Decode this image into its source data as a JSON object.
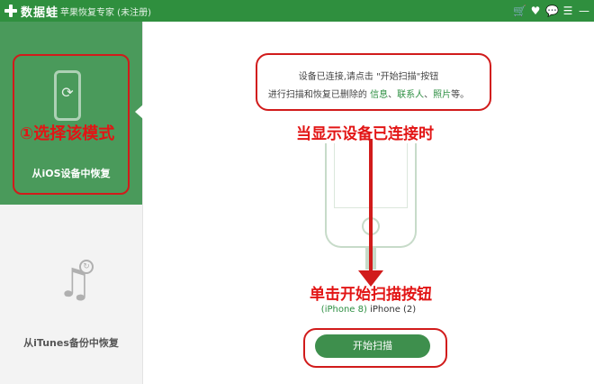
{
  "titlebar": {
    "app_name": "数据蛙",
    "subtitle": "苹果恢复专家 (未注册)",
    "controls": [
      "🛒",
      "♥",
      "💬",
      "☰",
      "—"
    ]
  },
  "sidebar": {
    "modes": [
      {
        "label": "从iOS设备中恢复",
        "active": true
      },
      {
        "label": "从iTunes备份中恢复",
        "active": false
      }
    ],
    "annotation": "①选择该模式"
  },
  "main": {
    "info_line1": "设备已连接,请点击 \"开始扫描\"按钮",
    "info_line2_prefix": "进行扫描和恢复已删除的 ",
    "links": [
      "信息",
      "联系人",
      "照片"
    ],
    "info_line2_sep": "、",
    "info_line2_suffix": "等。",
    "annotation_connected": "当显示设备已连接时",
    "annotation_click": "单击开始扫描按钮",
    "device_model": "(iPhone 8)",
    "device_name": "iPhone (2)",
    "scan_button": "开始扫描"
  },
  "colors": {
    "brand_green": "#2f8f3e",
    "sidebar_active": "#4a9a5b",
    "annotation_red": "#e21515"
  }
}
